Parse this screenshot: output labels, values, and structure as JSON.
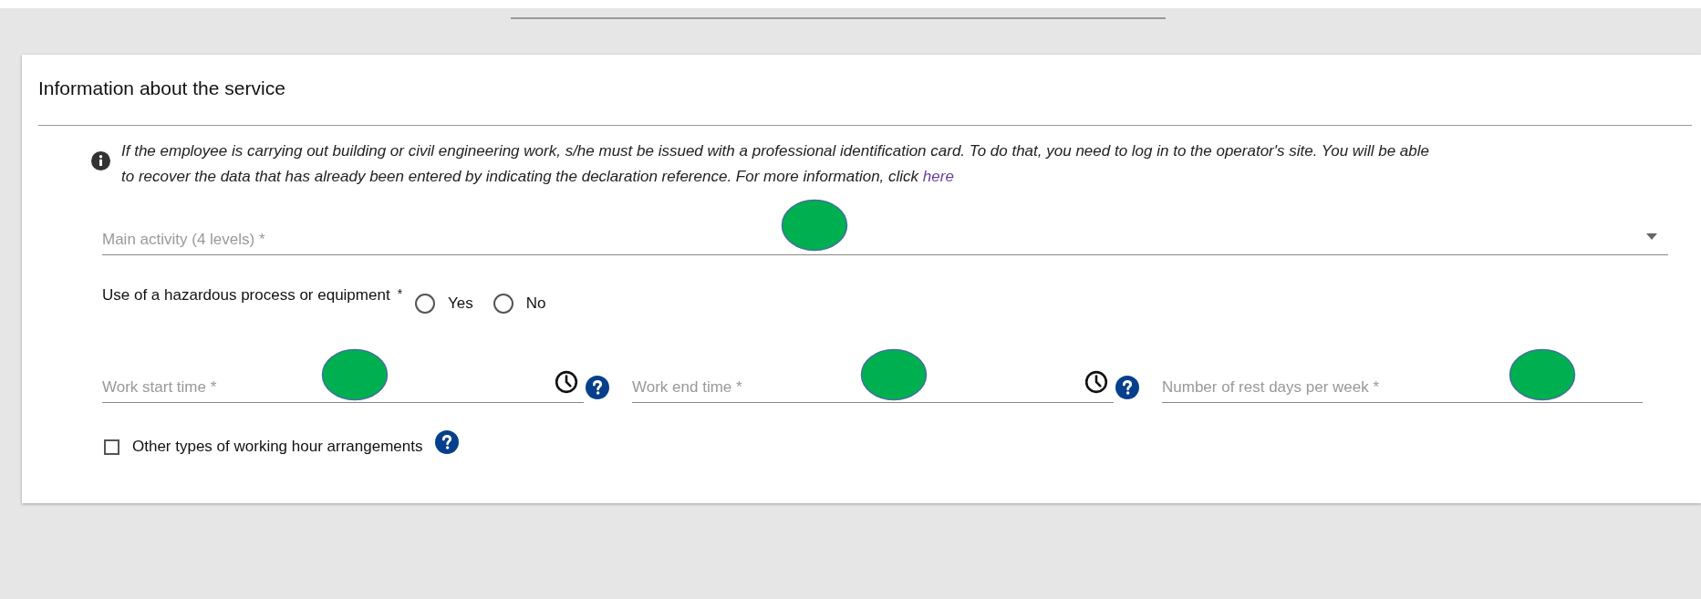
{
  "section": {
    "title": "Information about the service",
    "info_text": "If the employee is carrying out building or civil engineering work, s/he must be issued with a professional identification card. To do that, you need to log in to the operator's site. You will be able to recover the data that has already been entered by indicating the declaration reference. For more information, click",
    "info_link": "here"
  },
  "main_activity": {
    "placeholder": "Main activity (4 levels) *"
  },
  "hazardous": {
    "label": "Use of a hazardous process or equipment",
    "required_mark": "*",
    "options": [
      {
        "label": "Yes",
        "selected": false
      },
      {
        "label": "No",
        "selected": false
      }
    ]
  },
  "time_fields": [
    {
      "kind": "time",
      "placeholder": "Work start time  *"
    },
    {
      "kind": "time",
      "placeholder": "Work end time  *"
    },
    {
      "kind": "number",
      "placeholder": "Number of rest days per week  *"
    }
  ],
  "other_arrangements": {
    "label": "Other types of working hour arrangements",
    "checked": false
  }
}
